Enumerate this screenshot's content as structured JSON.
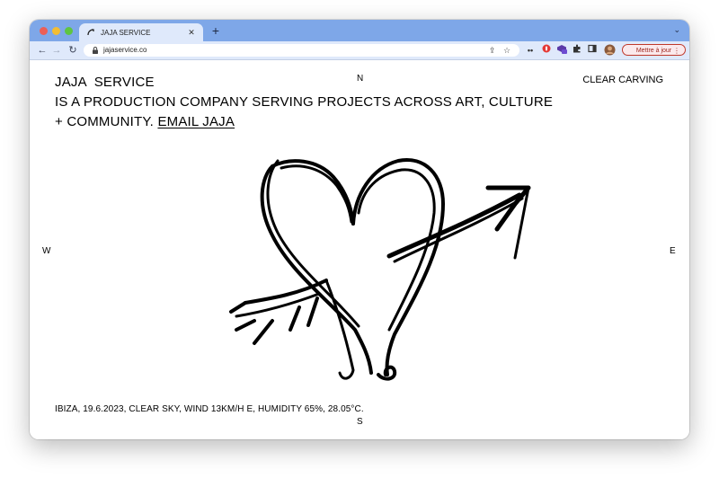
{
  "browser": {
    "tab_title": "JAJA SERVICE",
    "url": "jajaservice.co",
    "update_button": "Mettre à jour",
    "colors": {
      "tabstrip": "#7ea7e8",
      "toolbar": "#dfe9fb",
      "update_border": "#c0392b"
    }
  },
  "page": {
    "brand": "JAJA  SERVICE",
    "tagline": "IS A PRODUCTION COMPANY SERVING PROJECTS ACROSS ART, CULTURE + COMMUNITY.",
    "email_link": "EMAIL JAJA",
    "clear_carving": "CLEAR CARVING",
    "compass": {
      "n": "N",
      "s": "S",
      "w": "W",
      "e": "E"
    },
    "weather": "IBIZA, 19.6.2023, CLEAR SKY, WIND 13KM/H E, HUMIDITY 65%, 28.05°C.",
    "drawing_icon": "heart-with-arrow-icon"
  }
}
